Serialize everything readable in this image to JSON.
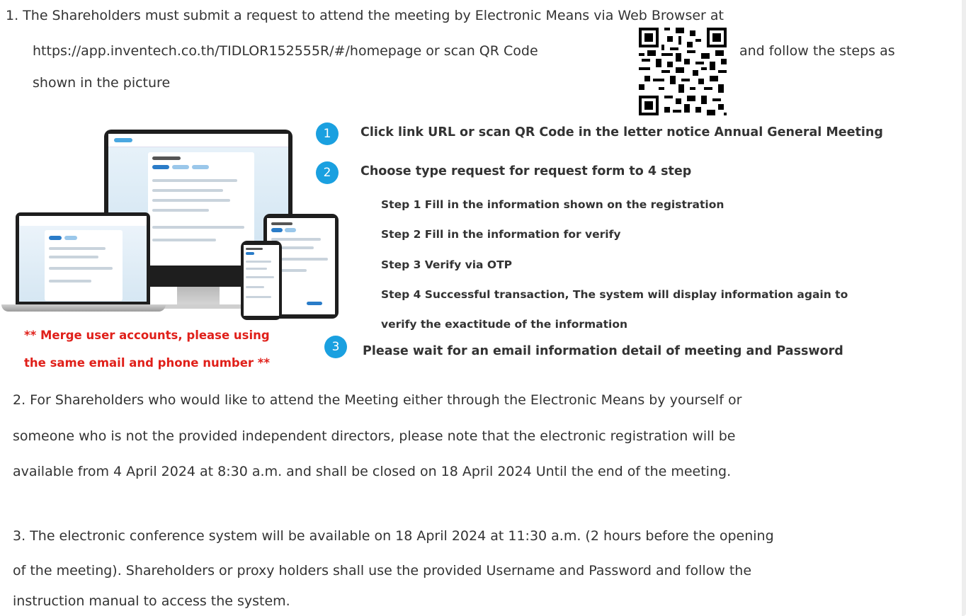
{
  "section1": {
    "line1": "1. The Shareholders must submit a request to attend the meeting by Electronic Means via Web Browser at",
    "line2_prefix": "https://app.inventech.co.th/TIDLOR152555R/#/homepage or scan QR Code",
    "line2_suffix": "and follow the steps as",
    "line3": "shown in the picture"
  },
  "steps": {
    "badge1": "1",
    "step1": "Click link URL or scan QR Code in the letter notice Annual General Meeting",
    "badge2": "2",
    "step2": "Choose type request for request form to 4 step",
    "sub1": "Step 1 Fill in the information shown on the registration",
    "sub2": "Step 2 Fill in the information for verify",
    "sub3": "Step 3 Verify via OTP",
    "sub4a": "Step 4 Successful transaction, The system will display information again to",
    "sub4b": "verify the exactitude of the information",
    "badge3": "3",
    "step3": "Please wait for an email information detail of meeting and Password"
  },
  "note": {
    "line1": "** Merge user accounts, please using",
    "line2": "the same email and phone number **"
  },
  "section2": {
    "line1": "2. For Shareholders who would like to attend the Meeting either through the Electronic Means by yourself or",
    "line2": "someone who is not the provided independent directors, please note that the electronic registration will be",
    "line3": "available from 4 April 2024 at 8:30 a.m. and shall be closed on 18 April 2024 Until the end of the meeting."
  },
  "section3": {
    "line1": "3. The electronic conference system will be available on 18 April 2024 at 11:30 a.m. (2 hours before the opening",
    "line2": "of the meeting). Shareholders or proxy holders shall use the provided Username and Password and follow the",
    "line3": "instruction manual to access the system."
  },
  "colors": {
    "badge": "#1aa0e0",
    "note": "#e0201a",
    "text": "#333333"
  }
}
